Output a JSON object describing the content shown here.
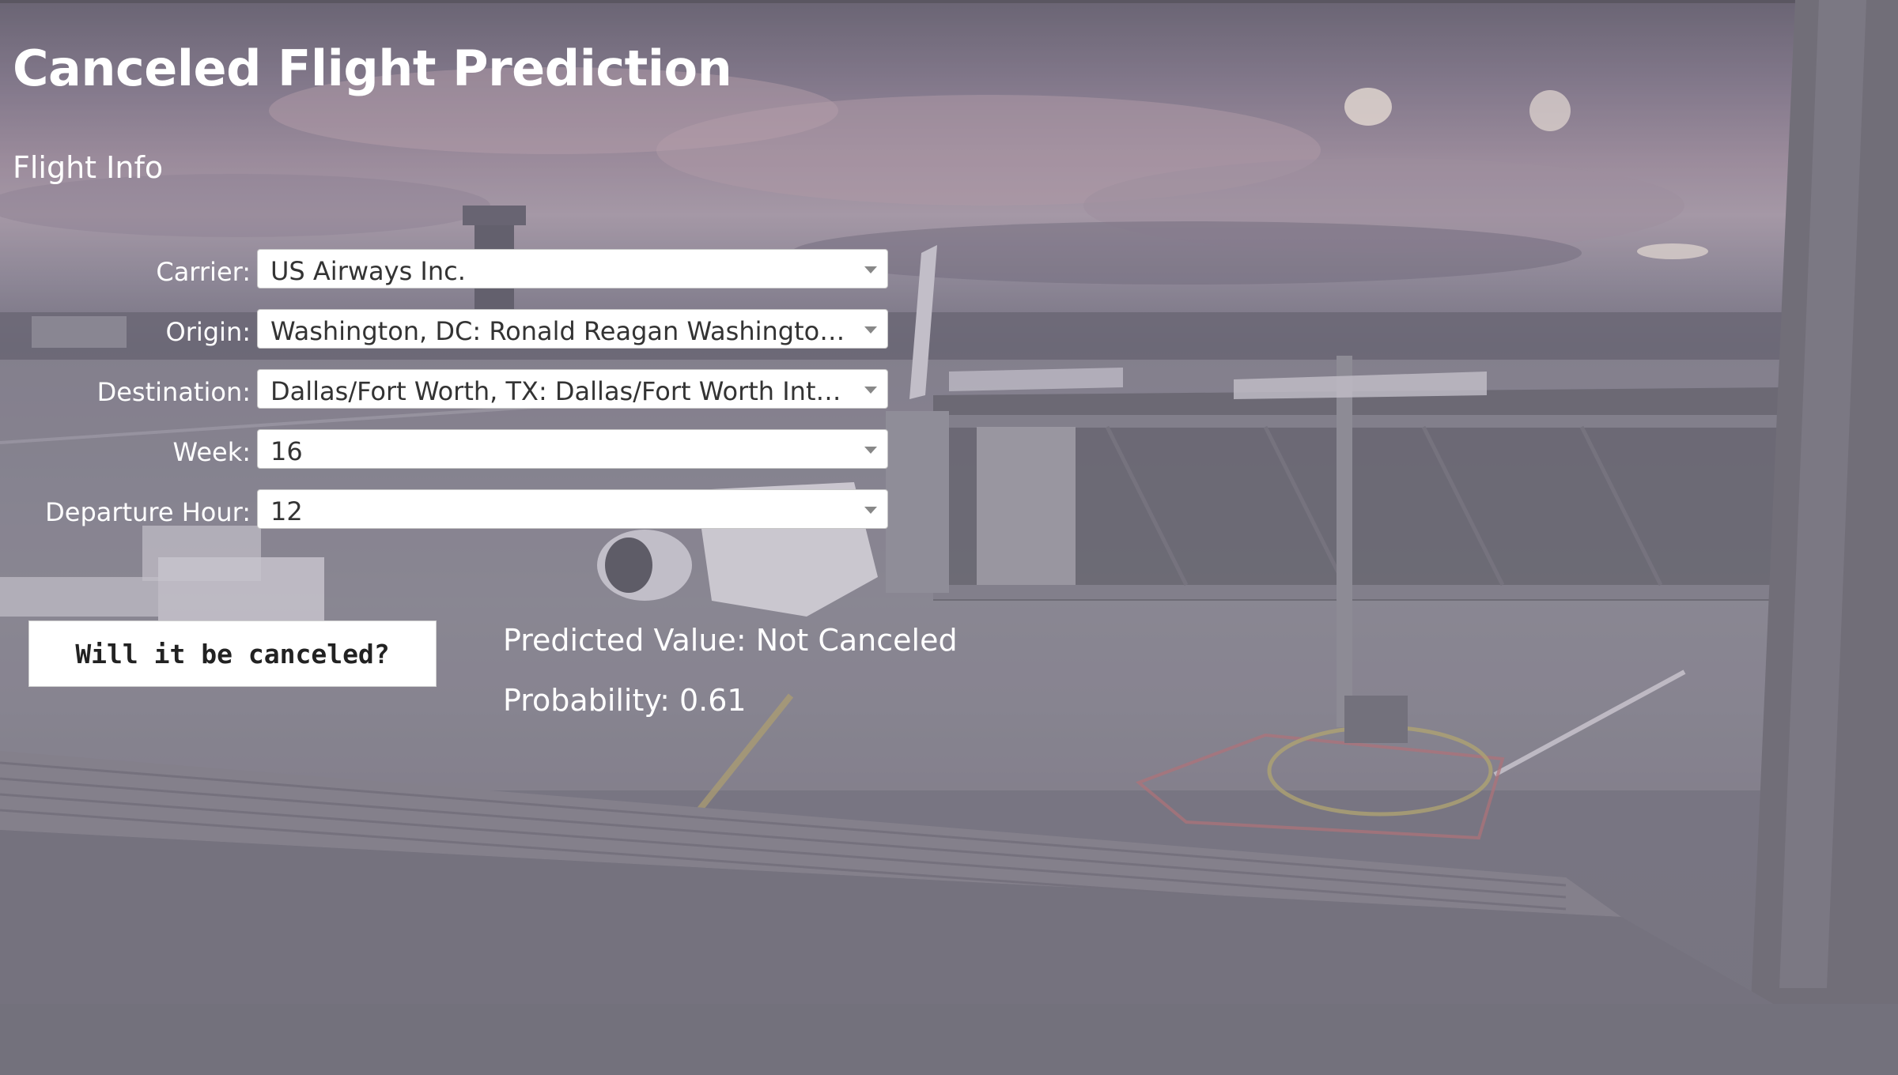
{
  "page_title": "Canceled Flight Prediction",
  "section_title": "Flight Info",
  "form": {
    "carrier": {
      "label": "Carrier:",
      "value": "US Airways Inc."
    },
    "origin": {
      "label": "Origin:",
      "value": "Washington, DC: Ronald Reagan Washington Na..."
    },
    "destination": {
      "label": "Destination:",
      "value": "Dallas/Fort Worth, TX: Dallas/Fort Worth Interna..."
    },
    "week": {
      "label": "Week:",
      "value": "16"
    },
    "departure_hour": {
      "label": "Departure Hour:",
      "value": "12"
    }
  },
  "predict_button": {
    "label": "Will it be canceled?"
  },
  "result": {
    "predicted_value": "Predicted Value: Not Canceled",
    "probability": "Probability: 0.61"
  }
}
